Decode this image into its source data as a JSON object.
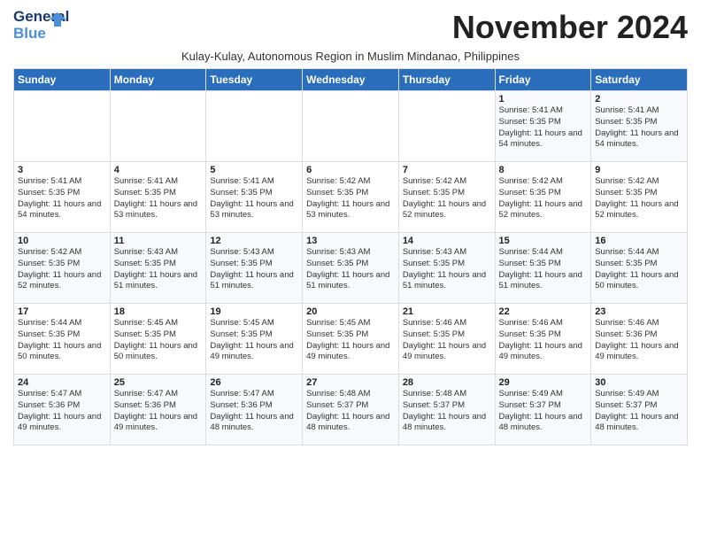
{
  "header": {
    "logo_line1": "General",
    "logo_line2": "Blue",
    "month_title": "November 2024",
    "subtitle": "Kulay-Kulay, Autonomous Region in Muslim Mindanao, Philippines"
  },
  "days_of_week": [
    "Sunday",
    "Monday",
    "Tuesday",
    "Wednesday",
    "Thursday",
    "Friday",
    "Saturday"
  ],
  "weeks": [
    [
      {
        "day": "",
        "info": ""
      },
      {
        "day": "",
        "info": ""
      },
      {
        "day": "",
        "info": ""
      },
      {
        "day": "",
        "info": ""
      },
      {
        "day": "",
        "info": ""
      },
      {
        "day": "1",
        "info": "Sunrise: 5:41 AM\nSunset: 5:35 PM\nDaylight: 11 hours and 54 minutes."
      },
      {
        "day": "2",
        "info": "Sunrise: 5:41 AM\nSunset: 5:35 PM\nDaylight: 11 hours and 54 minutes."
      }
    ],
    [
      {
        "day": "3",
        "info": "Sunrise: 5:41 AM\nSunset: 5:35 PM\nDaylight: 11 hours and 54 minutes."
      },
      {
        "day": "4",
        "info": "Sunrise: 5:41 AM\nSunset: 5:35 PM\nDaylight: 11 hours and 53 minutes."
      },
      {
        "day": "5",
        "info": "Sunrise: 5:41 AM\nSunset: 5:35 PM\nDaylight: 11 hours and 53 minutes."
      },
      {
        "day": "6",
        "info": "Sunrise: 5:42 AM\nSunset: 5:35 PM\nDaylight: 11 hours and 53 minutes."
      },
      {
        "day": "7",
        "info": "Sunrise: 5:42 AM\nSunset: 5:35 PM\nDaylight: 11 hours and 52 minutes."
      },
      {
        "day": "8",
        "info": "Sunrise: 5:42 AM\nSunset: 5:35 PM\nDaylight: 11 hours and 52 minutes."
      },
      {
        "day": "9",
        "info": "Sunrise: 5:42 AM\nSunset: 5:35 PM\nDaylight: 11 hours and 52 minutes."
      }
    ],
    [
      {
        "day": "10",
        "info": "Sunrise: 5:42 AM\nSunset: 5:35 PM\nDaylight: 11 hours and 52 minutes."
      },
      {
        "day": "11",
        "info": "Sunrise: 5:43 AM\nSunset: 5:35 PM\nDaylight: 11 hours and 51 minutes."
      },
      {
        "day": "12",
        "info": "Sunrise: 5:43 AM\nSunset: 5:35 PM\nDaylight: 11 hours and 51 minutes."
      },
      {
        "day": "13",
        "info": "Sunrise: 5:43 AM\nSunset: 5:35 PM\nDaylight: 11 hours and 51 minutes."
      },
      {
        "day": "14",
        "info": "Sunrise: 5:43 AM\nSunset: 5:35 PM\nDaylight: 11 hours and 51 minutes."
      },
      {
        "day": "15",
        "info": "Sunrise: 5:44 AM\nSunset: 5:35 PM\nDaylight: 11 hours and 51 minutes."
      },
      {
        "day": "16",
        "info": "Sunrise: 5:44 AM\nSunset: 5:35 PM\nDaylight: 11 hours and 50 minutes."
      }
    ],
    [
      {
        "day": "17",
        "info": "Sunrise: 5:44 AM\nSunset: 5:35 PM\nDaylight: 11 hours and 50 minutes."
      },
      {
        "day": "18",
        "info": "Sunrise: 5:45 AM\nSunset: 5:35 PM\nDaylight: 11 hours and 50 minutes."
      },
      {
        "day": "19",
        "info": "Sunrise: 5:45 AM\nSunset: 5:35 PM\nDaylight: 11 hours and 49 minutes."
      },
      {
        "day": "20",
        "info": "Sunrise: 5:45 AM\nSunset: 5:35 PM\nDaylight: 11 hours and 49 minutes."
      },
      {
        "day": "21",
        "info": "Sunrise: 5:46 AM\nSunset: 5:35 PM\nDaylight: 11 hours and 49 minutes."
      },
      {
        "day": "22",
        "info": "Sunrise: 5:46 AM\nSunset: 5:35 PM\nDaylight: 11 hours and 49 minutes."
      },
      {
        "day": "23",
        "info": "Sunrise: 5:46 AM\nSunset: 5:36 PM\nDaylight: 11 hours and 49 minutes."
      }
    ],
    [
      {
        "day": "24",
        "info": "Sunrise: 5:47 AM\nSunset: 5:36 PM\nDaylight: 11 hours and 49 minutes."
      },
      {
        "day": "25",
        "info": "Sunrise: 5:47 AM\nSunset: 5:36 PM\nDaylight: 11 hours and 49 minutes."
      },
      {
        "day": "26",
        "info": "Sunrise: 5:47 AM\nSunset: 5:36 PM\nDaylight: 11 hours and 48 minutes."
      },
      {
        "day": "27",
        "info": "Sunrise: 5:48 AM\nSunset: 5:37 PM\nDaylight: 11 hours and 48 minutes."
      },
      {
        "day": "28",
        "info": "Sunrise: 5:48 AM\nSunset: 5:37 PM\nDaylight: 11 hours and 48 minutes."
      },
      {
        "day": "29",
        "info": "Sunrise: 5:49 AM\nSunset: 5:37 PM\nDaylight: 11 hours and 48 minutes."
      },
      {
        "day": "30",
        "info": "Sunrise: 5:49 AM\nSunset: 5:37 PM\nDaylight: 11 hours and 48 minutes."
      }
    ]
  ]
}
